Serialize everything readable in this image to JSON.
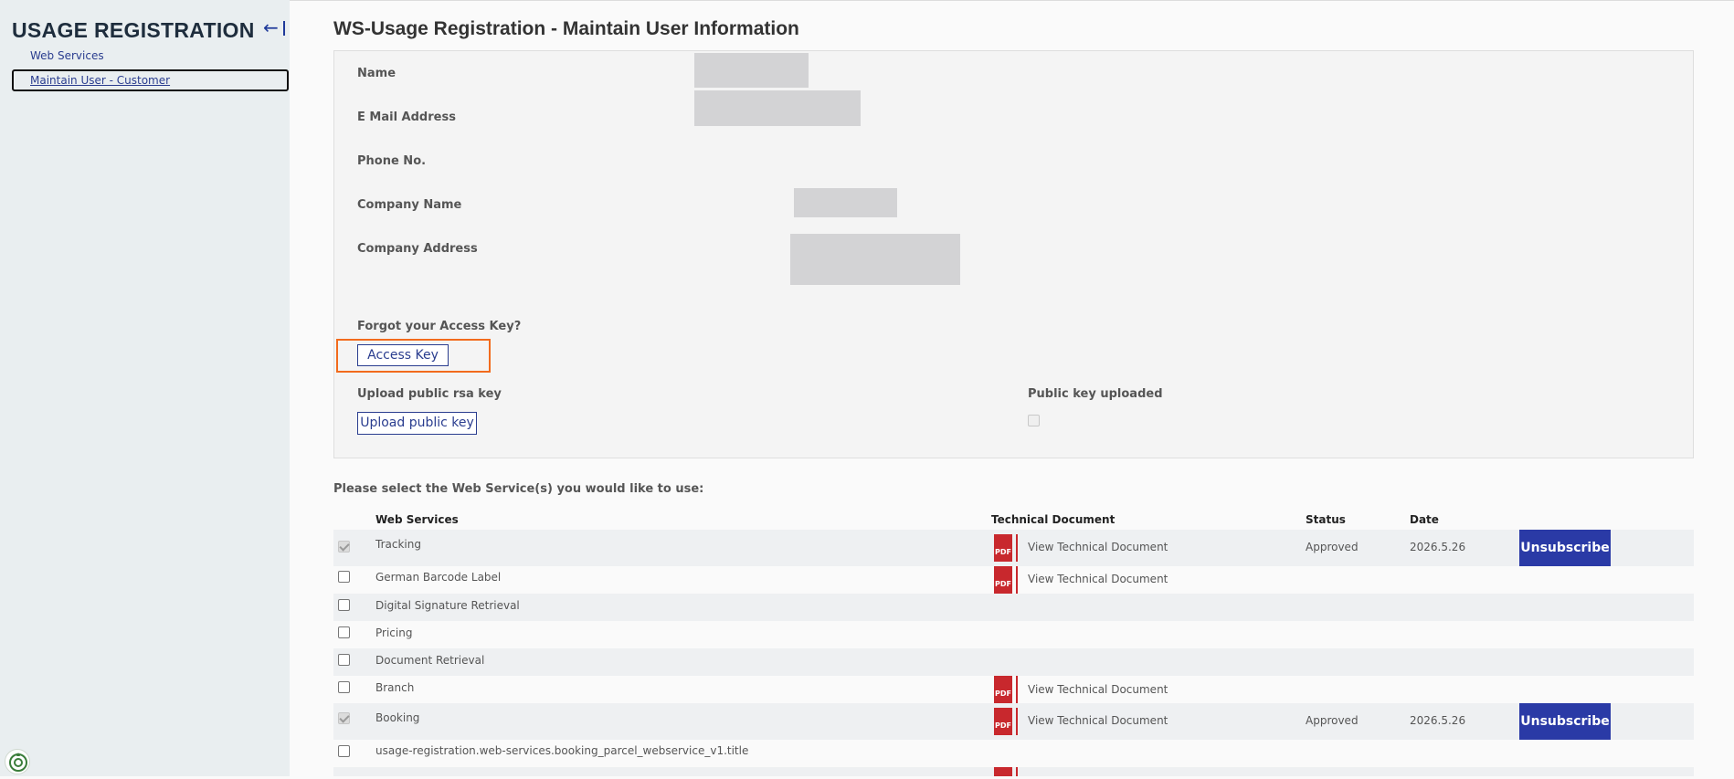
{
  "sidebar": {
    "title": "USAGE REGISTRATION",
    "collapse_icon": "arrow-left-bar-icon",
    "nav": [
      {
        "label": "Web Services"
      },
      {
        "label": "Maintain User - Customer"
      }
    ]
  },
  "page": {
    "title": "WS-Usage Registration - Maintain User Information"
  },
  "form": {
    "name_label": "Name",
    "email_label": "E Mail Address",
    "phone_label": "Phone No.",
    "company_name_label": "Company Name",
    "company_address_label": "Company Address",
    "forgot_label": "Forgot your Access Key?",
    "access_key_button": "Access Key",
    "upload_label": "Upload public rsa key",
    "upload_button": "Upload public key",
    "public_key_uploaded_label": "Public key uploaded",
    "public_key_uploaded": false
  },
  "services": {
    "instruction": "Please select the Web Service(s) you would like to use:",
    "headers": {
      "web_services": "Web Services",
      "technical_document": "Technical Document",
      "status": "Status",
      "date": "Date"
    },
    "rows": [
      {
        "name": "Tracking",
        "checked": true,
        "doc": "View Technical Document",
        "status": "Approved",
        "date": "2026.5.26",
        "action": "Unsubscribe"
      },
      {
        "name": "German Barcode Label",
        "checked": false,
        "doc": "View Technical Document",
        "status": "",
        "date": "",
        "action": ""
      },
      {
        "name": "Digital Signature Retrieval",
        "checked": false,
        "doc": "",
        "status": "",
        "date": "",
        "action": ""
      },
      {
        "name": "Pricing",
        "checked": false,
        "doc": "",
        "status": "",
        "date": "",
        "action": ""
      },
      {
        "name": "Document Retrieval",
        "checked": false,
        "doc": "",
        "status": "",
        "date": "",
        "action": ""
      },
      {
        "name": "Branch",
        "checked": false,
        "doc": "View Technical Document",
        "status": "",
        "date": "",
        "action": ""
      },
      {
        "name": "Booking",
        "checked": true,
        "doc": "View Technical Document",
        "status": "Approved",
        "date": "2026.5.26",
        "action": "Unsubscribe"
      },
      {
        "name": "usage-registration.web-services.booking_parcel_webservice_v1.title",
        "checked": false,
        "doc": "",
        "status": "",
        "date": "",
        "action": ""
      }
    ]
  },
  "colors": {
    "accent": "#2a3aa6",
    "highlight": "#f26b1d",
    "pdf_red": "#c8282d"
  }
}
